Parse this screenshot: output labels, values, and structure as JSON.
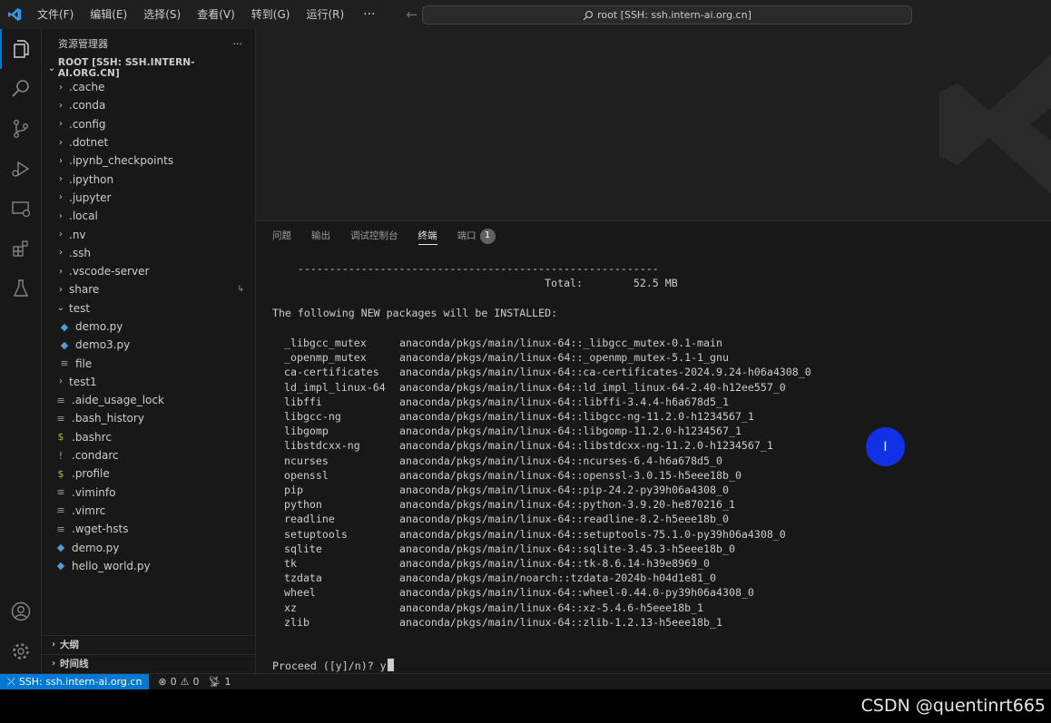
{
  "titlebar": {
    "menus": [
      "文件(F)",
      "编辑(E)",
      "选择(S)",
      "查看(V)",
      "转到(G)",
      "运行(R)"
    ],
    "more": "···",
    "search_text": "root [SSH: ssh.intern-ai.org.cn]",
    "back": "←",
    "forward": "→"
  },
  "sidebar": {
    "title": "资源管理器",
    "more": "···",
    "root_label": "ROOT [SSH: SSH.INTERN-AI.ORG.CN]",
    "items": [
      {
        "label": ".cache",
        "kind": "folder",
        "indent": 1
      },
      {
        "label": ".conda",
        "kind": "folder",
        "indent": 1
      },
      {
        "label": ".config",
        "kind": "folder",
        "indent": 1
      },
      {
        "label": ".dotnet",
        "kind": "folder",
        "indent": 1
      },
      {
        "label": ".ipynb_checkpoints",
        "kind": "folder",
        "indent": 1
      },
      {
        "label": ".ipython",
        "kind": "folder",
        "indent": 1
      },
      {
        "label": ".jupyter",
        "kind": "folder",
        "indent": 1
      },
      {
        "label": ".local",
        "kind": "folder",
        "indent": 1
      },
      {
        "label": ".nv",
        "kind": "folder",
        "indent": 1
      },
      {
        "label": ".ssh",
        "kind": "folder",
        "indent": 1
      },
      {
        "label": ".vscode-server",
        "kind": "folder",
        "indent": 1
      },
      {
        "label": "share",
        "kind": "folder",
        "indent": 1
      },
      {
        "label": "test",
        "kind": "folder-open",
        "indent": 1
      },
      {
        "label": "demo.py",
        "kind": "python",
        "indent": 2
      },
      {
        "label": "demo3.py",
        "kind": "python",
        "indent": 2
      },
      {
        "label": "file",
        "kind": "text",
        "indent": 2
      },
      {
        "label": "test1",
        "kind": "folder",
        "indent": 1
      },
      {
        "label": ".aide_usage_lock",
        "kind": "text",
        "indent": 1
      },
      {
        "label": ".bash_history",
        "kind": "text",
        "indent": 1
      },
      {
        "label": ".bashrc",
        "kind": "shell",
        "indent": 1
      },
      {
        "label": ".condarc",
        "kind": "config",
        "indent": 1
      },
      {
        "label": ".profile",
        "kind": "shell",
        "indent": 1
      },
      {
        "label": ".viminfo",
        "kind": "text",
        "indent": 1
      },
      {
        "label": ".vimrc",
        "kind": "text",
        "indent": 1
      },
      {
        "label": ".wget-hsts",
        "kind": "text",
        "indent": 1
      },
      {
        "label": "demo.py",
        "kind": "python",
        "indent": 1
      },
      {
        "label": "hello_world.py",
        "kind": "python",
        "indent": 1
      }
    ],
    "outline_label": "大纲",
    "timeline_label": "时间线"
  },
  "panel": {
    "tabs": [
      "问题",
      "输出",
      "调试控制台",
      "终端",
      "端口"
    ],
    "active_tab": "终端",
    "ports_badge": "1"
  },
  "terminal": {
    "separator": "    ---------------------------------------------------------",
    "total_line": "                                           Total:        52.5 MB",
    "heading": "The following NEW packages will be INSTALLED:",
    "packages": [
      {
        "name": "_libgcc_mutex",
        "src": "anaconda/pkgs/main/linux-64::_libgcc_mutex-0.1-main"
      },
      {
        "name": "_openmp_mutex",
        "src": "anaconda/pkgs/main/linux-64::_openmp_mutex-5.1-1_gnu"
      },
      {
        "name": "ca-certificates",
        "src": "anaconda/pkgs/main/linux-64::ca-certificates-2024.9.24-h06a4308_0"
      },
      {
        "name": "ld_impl_linux-64",
        "src": "anaconda/pkgs/main/linux-64::ld_impl_linux-64-2.40-h12ee557_0"
      },
      {
        "name": "libffi",
        "src": "anaconda/pkgs/main/linux-64::libffi-3.4.4-h6a678d5_1"
      },
      {
        "name": "libgcc-ng",
        "src": "anaconda/pkgs/main/linux-64::libgcc-ng-11.2.0-h1234567_1"
      },
      {
        "name": "libgomp",
        "src": "anaconda/pkgs/main/linux-64::libgomp-11.2.0-h1234567_1"
      },
      {
        "name": "libstdcxx-ng",
        "src": "anaconda/pkgs/main/linux-64::libstdcxx-ng-11.2.0-h1234567_1"
      },
      {
        "name": "ncurses",
        "src": "anaconda/pkgs/main/linux-64::ncurses-6.4-h6a678d5_0"
      },
      {
        "name": "openssl",
        "src": "anaconda/pkgs/main/linux-64::openssl-3.0.15-h5eee18b_0"
      },
      {
        "name": "pip",
        "src": "anaconda/pkgs/main/linux-64::pip-24.2-py39h06a4308_0"
      },
      {
        "name": "python",
        "src": "anaconda/pkgs/main/linux-64::python-3.9.20-he870216_1"
      },
      {
        "name": "readline",
        "src": "anaconda/pkgs/main/linux-64::readline-8.2-h5eee18b_0"
      },
      {
        "name": "setuptools",
        "src": "anaconda/pkgs/main/linux-64::setuptools-75.1.0-py39h06a4308_0"
      },
      {
        "name": "sqlite",
        "src": "anaconda/pkgs/main/linux-64::sqlite-3.45.3-h5eee18b_0"
      },
      {
        "name": "tk",
        "src": "anaconda/pkgs/main/linux-64::tk-8.6.14-h39e8969_0"
      },
      {
        "name": "tzdata",
        "src": "anaconda/pkgs/main/noarch::tzdata-2024b-h04d1e81_0"
      },
      {
        "name": "wheel",
        "src": "anaconda/pkgs/main/linux-64::wheel-0.44.0-py39h06a4308_0"
      },
      {
        "name": "xz",
        "src": "anaconda/pkgs/main/linux-64::xz-5.4.6-h5eee18b_1"
      },
      {
        "name": "zlib",
        "src": "anaconda/pkgs/main/linux-64::zlib-1.2.13-h5eee18b_1"
      }
    ],
    "prompt": "Proceed ([y]/n)? y"
  },
  "statusbar": {
    "remote": "SSH: ssh.intern-ai.org.cn",
    "errors": "0",
    "warnings": "0",
    "ports": "1"
  },
  "watermark": "CSDN @quentinrt665",
  "colors": {
    "accent": "#0078d4",
    "python_icon": "#4b9fd5",
    "shell_icon": "#8dc149",
    "config_icon": "#c586c0"
  }
}
